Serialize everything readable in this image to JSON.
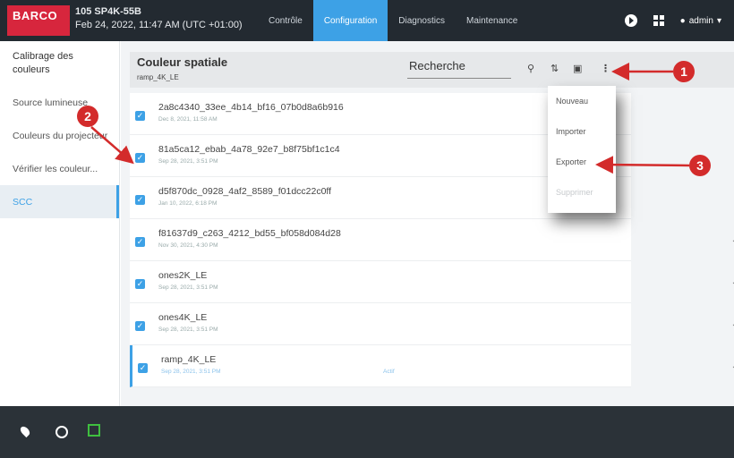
{
  "header": {
    "brand": "BARCO",
    "device_name": "105 SP4K-55B",
    "datetime": "Feb 24, 2022, 11:47 AM (UTC +01:00)",
    "tabs": [
      {
        "label": "Contrôle",
        "active": false
      },
      {
        "label": "Configuration",
        "active": true
      },
      {
        "label": "Diagnostics",
        "active": false
      },
      {
        "label": "Maintenance",
        "active": false
      }
    ],
    "user": "admin"
  },
  "sidebar": {
    "title": "Calibrage des couleurs",
    "items": [
      {
        "label": "Source lumineuse"
      },
      {
        "label": "Couleurs du projecteur"
      },
      {
        "label": "Vérifier les couleur..."
      },
      {
        "label": "SCC",
        "active": true
      }
    ]
  },
  "panel": {
    "title": "Couleur spatiale",
    "subtitle": "ramp_4K_LE",
    "search_placeholder": "Recherche"
  },
  "rows": [
    {
      "name": "2a8c4340_33ee_4b14_bf16_07b0d8a6b916",
      "date": "Dec 8, 2021, 11:58 AM"
    },
    {
      "name": "81a5ca12_ebab_4a78_92e7_b8f75bf1c1c4",
      "date": "Sep 28, 2021, 3:51 PM"
    },
    {
      "name": "d5f870dc_0928_4af2_8589_f01dcc22c0ff",
      "date": "Jan 10, 2022, 6:18 PM"
    },
    {
      "name": "f81637d9_c263_4212_bd55_bf058d084d28",
      "date": "Nov 30, 2021, 4:30 PM"
    },
    {
      "name": "ones2K_LE",
      "date": "Sep 28, 2021, 3:51 PM"
    },
    {
      "name": "ones4K_LE",
      "date": "Sep 28, 2021, 3:51 PM"
    },
    {
      "name": "ramp_4K_LE",
      "date": "Sep 28, 2021, 3:51 PM",
      "status": "Actif",
      "selected": true
    }
  ],
  "menu": {
    "items": [
      {
        "label": "Nouveau"
      },
      {
        "label": "Importer"
      },
      {
        "label": "Exporter"
      },
      {
        "label": "Supprimer",
        "disabled": true
      }
    ]
  },
  "callouts": [
    "1",
    "2",
    "3"
  ],
  "colors": {
    "accent": "#3da1e6",
    "brand": "#d7263d",
    "callout": "#d32b2b"
  }
}
